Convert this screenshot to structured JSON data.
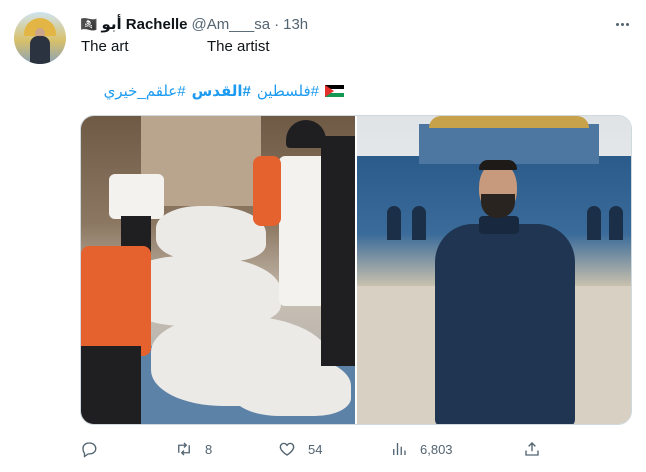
{
  "tweet": {
    "author": {
      "flag_icon": "skull-crossbones-icon",
      "display_name": "أبو Rachelle",
      "handle": "@Am___sa",
      "separator": "·",
      "time": "13h"
    },
    "text": {
      "left": "The art",
      "right": "The artist"
    },
    "hashtags": {
      "flag_icon": "palestine-flag-icon",
      "items": [
        "#فلسطين",
        "#القدس",
        "#علقم_خيري"
      ]
    },
    "media_images": [
      "left-photo",
      "right-photo"
    ],
    "actions": {
      "reply": {
        "icon": "reply-icon",
        "count": ""
      },
      "retweet": {
        "icon": "retweet-icon",
        "count": "8"
      },
      "like": {
        "icon": "heart-icon",
        "count": "54"
      },
      "views": {
        "icon": "views-icon",
        "count": "6,803"
      },
      "share": {
        "icon": "share-icon",
        "count": ""
      }
    }
  },
  "colors": {
    "link": "#1d9bf0",
    "muted": "#536471",
    "text": "#0f1419",
    "border": "#cfd9de"
  }
}
